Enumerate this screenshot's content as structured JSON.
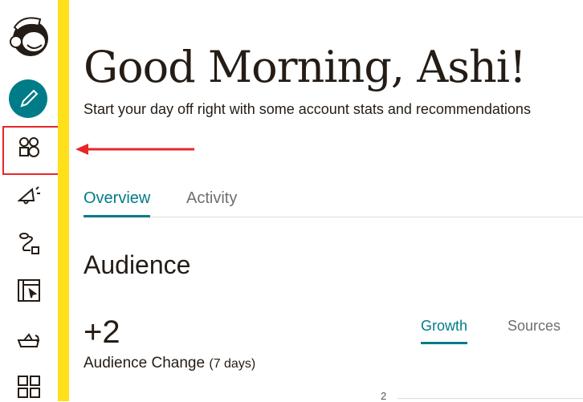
{
  "header": {
    "greeting": "Good Morning, Ashi!",
    "subtitle": "Start your day off right with some account stats and recommendations"
  },
  "tabs": [
    {
      "label": "Overview",
      "active": true
    },
    {
      "label": "Activity",
      "active": false
    }
  ],
  "audience": {
    "title": "Audience",
    "change_value": "+2",
    "change_label": "Audience Change",
    "period": "(7 days)",
    "tabs": [
      {
        "label": "Growth",
        "active": true
      },
      {
        "label": "Sources",
        "active": false
      }
    ],
    "y_tick": "2"
  },
  "sidebar": {
    "items": [
      "logo-icon",
      "create-icon",
      "audience-icon",
      "campaigns-icon",
      "automations-icon",
      "website-icon",
      "integrations-icon",
      "dashboard-icon"
    ],
    "highlighted": "audience-icon"
  },
  "colors": {
    "accent": "#007c89",
    "yellow": "#ffe01b",
    "highlight": "#e8262a"
  }
}
